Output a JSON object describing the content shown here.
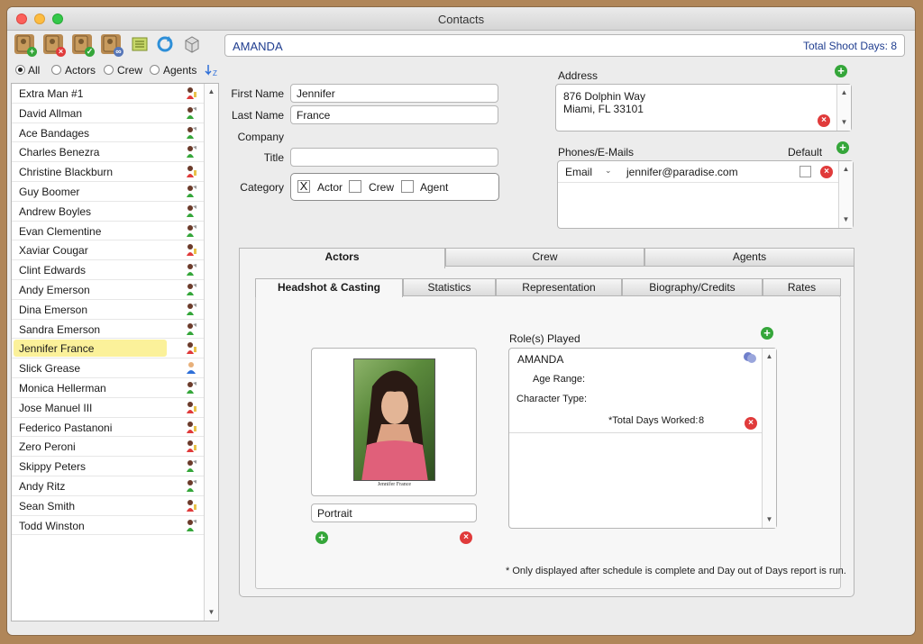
{
  "window": {
    "title": "Contacts"
  },
  "toolbar": {
    "contact_name": "AMANDA",
    "total_shoot_days": "Total Shoot Days: 8",
    "buttons": [
      "add-contact-icon",
      "delete-contact-icon",
      "edit-contact-icon",
      "link-contact-icon",
      "list-icon",
      "refresh-icon",
      "box-icon"
    ]
  },
  "filters": {
    "options": [
      "All",
      "Actors",
      "Crew",
      "Agents"
    ],
    "selected": "All"
  },
  "contacts": [
    {
      "name": "Extra Man #1",
      "icon": "actor-female-icon"
    },
    {
      "name": "David Allman",
      "icon": "actor-male-icon"
    },
    {
      "name": "Ace Bandages",
      "icon": "actor-male-icon"
    },
    {
      "name": "Charles Benezra",
      "icon": "actor-male-icon"
    },
    {
      "name": "Christine Blackburn",
      "icon": "actor-female-icon"
    },
    {
      "name": "Guy Boomer",
      "icon": "actor-male-icon"
    },
    {
      "name": "Andrew Boyles",
      "icon": "actor-male-icon"
    },
    {
      "name": "Evan Clementine",
      "icon": "actor-male-icon"
    },
    {
      "name": "Xaviar Cougar",
      "icon": "actor-female-icon"
    },
    {
      "name": "Clint Edwards",
      "icon": "actor-male-icon"
    },
    {
      "name": "Andy Emerson",
      "icon": "actor-male-icon"
    },
    {
      "name": "Dina Emerson",
      "icon": "actor-male-icon"
    },
    {
      "name": "Sandra Emerson",
      "icon": "actor-male-icon"
    },
    {
      "name": "Jennifer France",
      "icon": "actor-female-icon",
      "selected": true
    },
    {
      "name": "Slick Grease",
      "icon": "crew-icon"
    },
    {
      "name": "Monica Hellerman",
      "icon": "actor-male-icon"
    },
    {
      "name": "Jose Manuel III",
      "icon": "actor-female-icon"
    },
    {
      "name": "Federico Pastanoni",
      "icon": "actor-female-icon"
    },
    {
      "name": "Zero Peroni",
      "icon": "actor-female-icon"
    },
    {
      "name": "Skippy Peters",
      "icon": "actor-male-icon"
    },
    {
      "name": "Andy Ritz",
      "icon": "actor-male-icon"
    },
    {
      "name": "Sean Smith",
      "icon": "actor-female-icon"
    },
    {
      "name": "Todd Winston",
      "icon": "actor-male-icon"
    }
  ],
  "form": {
    "first_name_label": "First Name",
    "first_name": "Jennifer",
    "last_name_label": "Last Name",
    "last_name": "France",
    "company_label": "Company",
    "title_label": "Title",
    "title": "",
    "category_label": "Category",
    "categories": [
      {
        "label": "Actor",
        "checked": true,
        "mark": "X"
      },
      {
        "label": "Crew",
        "checked": false,
        "mark": ""
      },
      {
        "label": "Agent",
        "checked": false,
        "mark": ""
      }
    ]
  },
  "address": {
    "label": "Address",
    "line1": "876 Dolphin Way",
    "line2": "Miami, FL 33101"
  },
  "phones": {
    "label": "Phones/E-Mails",
    "default_label": "Default",
    "entries": [
      {
        "type": "Email",
        "value": "jennifer@paradise.com",
        "default": false
      }
    ]
  },
  "main_tabs": [
    {
      "label": "Actors",
      "active": true
    },
    {
      "label": "Crew",
      "active": false
    },
    {
      "label": "Agents",
      "active": false
    }
  ],
  "sub_tabs": [
    {
      "label": "Headshot & Casting",
      "active": true
    },
    {
      "label": "Statistics",
      "active": false
    },
    {
      "label": "Representation",
      "active": false
    },
    {
      "label": "Biography/Credits",
      "active": false
    },
    {
      "label": "Rates",
      "active": false
    }
  ],
  "headshot": {
    "caption": "Jennifer France",
    "type_value": "Portrait"
  },
  "roles": {
    "label": "Role(s) Played",
    "items": [
      {
        "name": "AMANDA",
        "age_range_label": "Age Range:",
        "character_type_label": "Character Type:",
        "total_days_label": "*Total Days Worked:",
        "total_days_value": "8"
      }
    ]
  },
  "footnote": "* Only displayed after schedule is complete and Day out of Days report is run.",
  "colors": {
    "name_blue": "#1f3d8f",
    "add_green": "#35a63a",
    "delete_red": "#e03b3b",
    "selection_yellow": "#fbf19a"
  }
}
